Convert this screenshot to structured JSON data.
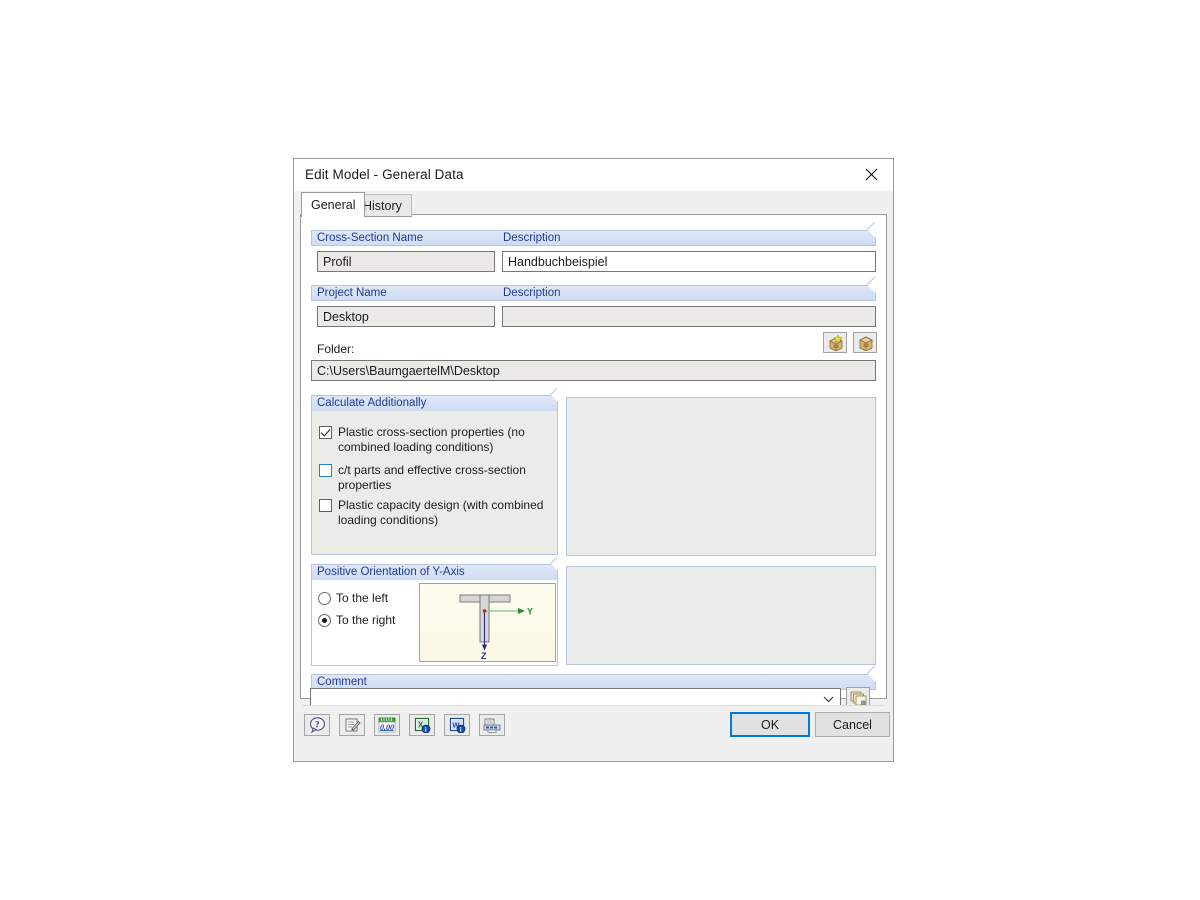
{
  "window": {
    "title": "Edit Model - General Data",
    "close_icon": "close-icon"
  },
  "tabs": [
    {
      "label": "General",
      "active": true
    },
    {
      "label": "History",
      "active": false
    }
  ],
  "sections": {
    "cross_section": {
      "name_header": "Cross-Section Name",
      "name_value": "Profil",
      "description_header": "Description",
      "description_value": "Handbuchbeispiel"
    },
    "project": {
      "name_header": "Project Name",
      "name_value": "Desktop",
      "description_header": "Description",
      "description_value": "",
      "folder_label": "Folder:",
      "folder_value": "C:\\Users\\BaumgaertelM\\Desktop",
      "new_project_icon": "new-project-box-icon",
      "open_project_icon": "open-project-box-icon"
    },
    "calculate": {
      "header": "Calculate Additionally",
      "options": [
        {
          "label": "Plastic cross-section properties (no combined loading conditions)",
          "checked": true,
          "highlight": false
        },
        {
          "label": "c/t parts and effective cross-section properties",
          "checked": false,
          "highlight": true
        },
        {
          "label": "Plastic capacity design (with combined loading conditions)",
          "checked": false,
          "highlight": false
        }
      ]
    },
    "orientation": {
      "header": "Positive Orientation of Y-Axis",
      "options": [
        {
          "label": "To the left",
          "selected": false
        },
        {
          "label": "To the right",
          "selected": true
        }
      ],
      "axis_y_label": "Y",
      "axis_z_label": "Z"
    },
    "comment": {
      "header": "Comment",
      "value": "",
      "dropdown_icon": "chevron-down-icon",
      "templates_icon": "comment-templates-icon"
    }
  },
  "toolbar": [
    {
      "icon": "help-icon",
      "name": "help-button"
    },
    {
      "icon": "edit-note-icon",
      "name": "edit-note-button"
    },
    {
      "icon": "units-icon",
      "name": "units-button"
    },
    {
      "icon": "excel-export-icon",
      "name": "excel-export-button"
    },
    {
      "icon": "word-export-icon",
      "name": "word-export-button"
    },
    {
      "icon": "printout-report-icon",
      "name": "printout-report-button"
    }
  ],
  "buttons": {
    "ok": "OK",
    "cancel": "Cancel"
  },
  "colors": {
    "header_text": "#1f3a93",
    "header_gradient_top": "#dfe8f7",
    "panel_bg": "#ebebe7",
    "focus_blue": "#0078d7",
    "axis_y": "#3aa03a",
    "axis_z": "#2a2a8c"
  }
}
